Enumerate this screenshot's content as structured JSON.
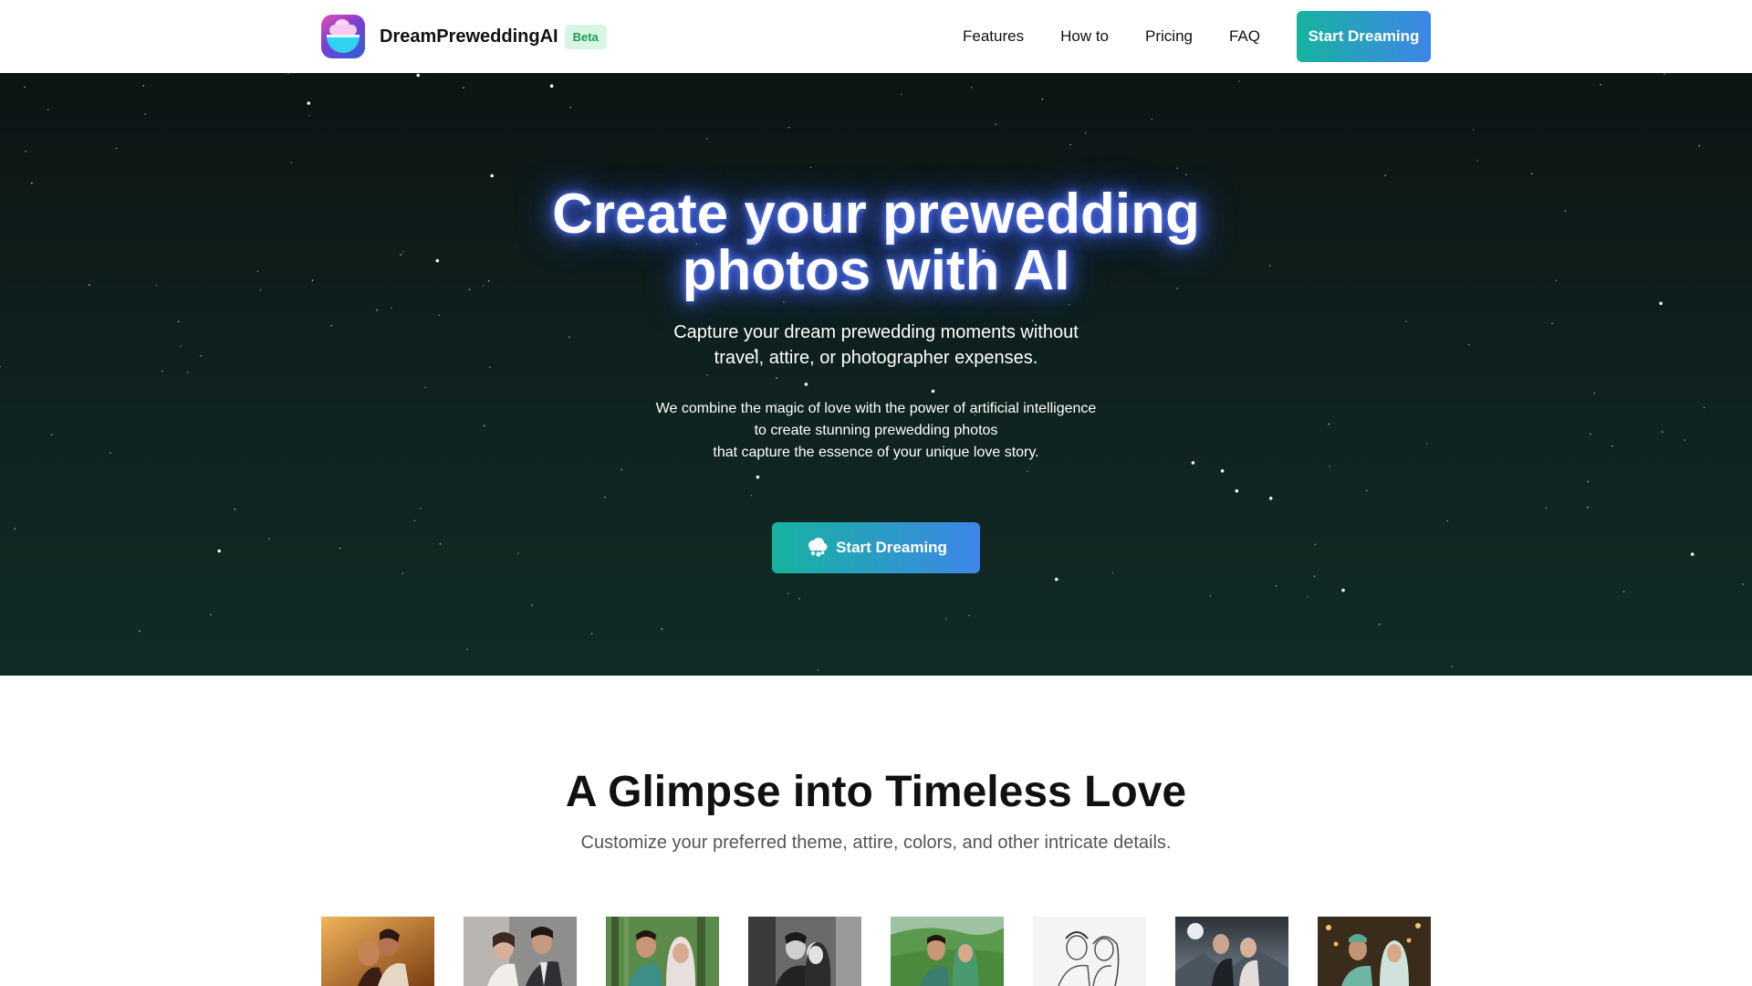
{
  "nav": {
    "brand": "DreamPreweddingAI",
    "badge": "Beta",
    "links": [
      "Features",
      "How to",
      "Pricing",
      "FAQ"
    ],
    "cta": "Start Dreaming"
  },
  "hero": {
    "title_line1": "Create your prewedding",
    "title_line2": "photos with AI",
    "subtitle_line1": "Capture your dream prewedding moments without",
    "subtitle_line2": "travel, attire, or photographer expenses.",
    "desc_line1": "We combine the magic of love with the power of artificial intelligence",
    "desc_line2": "to create stunning prewedding photos",
    "desc_line3": "that capture the essence of your unique love story.",
    "cta": "Start Dreaming",
    "cta_icon": "cloud-icon"
  },
  "section": {
    "title": "A Glimpse into Timeless Love",
    "subtitle": "Customize your preferred theme, attire, colors, and other intricate details."
  },
  "gallery": [
    {
      "name": "golden-couple-photo"
    },
    {
      "name": "bridal-couple-photo"
    },
    {
      "name": "forest-couple-photo"
    },
    {
      "name": "bw-couple-photo"
    },
    {
      "name": "tea-field-couple-photo"
    },
    {
      "name": "sketch-couple-photo"
    },
    {
      "name": "moon-couple-photo"
    },
    {
      "name": "festive-couple-photo"
    }
  ],
  "colors": {
    "accent_start": "#17b3a0",
    "accent_end": "#3e86e8",
    "hero_bg": "#0f2420",
    "badge_bg": "#d8f6e4",
    "badge_text": "#1f9a55"
  }
}
